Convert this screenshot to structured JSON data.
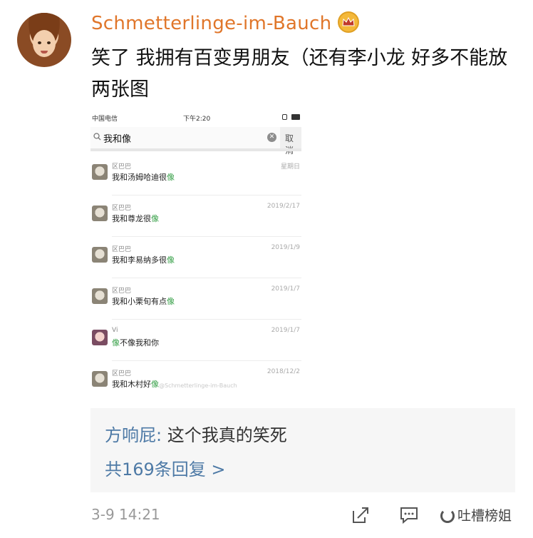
{
  "post": {
    "username": "Schmetterlinge-im-Bauch",
    "text": "笑了 我拥有百变男朋友（还有李小龙 好多不能放两张图",
    "time": "3-9 14:21"
  },
  "screenshot": {
    "carrier": "中国电信",
    "clock": "下午2:20",
    "search_query": "我和像",
    "cancel_label": "取消",
    "chats": [
      {
        "name": "区巴巴",
        "msg": "我和汤姆哈迪很",
        "highlight": "像",
        "date": "星期日"
      },
      {
        "name": "区巴巴",
        "msg": "我和尊龙很",
        "highlight": "像",
        "date": "2019/2/17"
      },
      {
        "name": "区巴巴",
        "msg": "我和李易纳多很",
        "highlight": "像",
        "date": "2019/1/9"
      },
      {
        "name": "区巴巴",
        "msg": "我和小栗旬有点",
        "highlight": "像",
        "date": "2019/1/7"
      },
      {
        "name": "Vi",
        "msg": "像不像我和你",
        "highlight": "",
        "date": "2019/1/7"
      },
      {
        "name": "区巴巴",
        "msg": "我和木村好",
        "highlight": "像",
        "date": "2018/12/2"
      }
    ],
    "watermark": "@Schmetterlinge-im-Bauch"
  },
  "comments": {
    "first_author": "方响屁:",
    "first_text": " 这个我真的笑死",
    "more_label": "共169条回复 >"
  },
  "footer": {
    "brand": "吐槽榜姐"
  },
  "colors": {
    "username": "#e0762a",
    "link": "#4e7aa6",
    "highlight": "#3aa14b"
  }
}
